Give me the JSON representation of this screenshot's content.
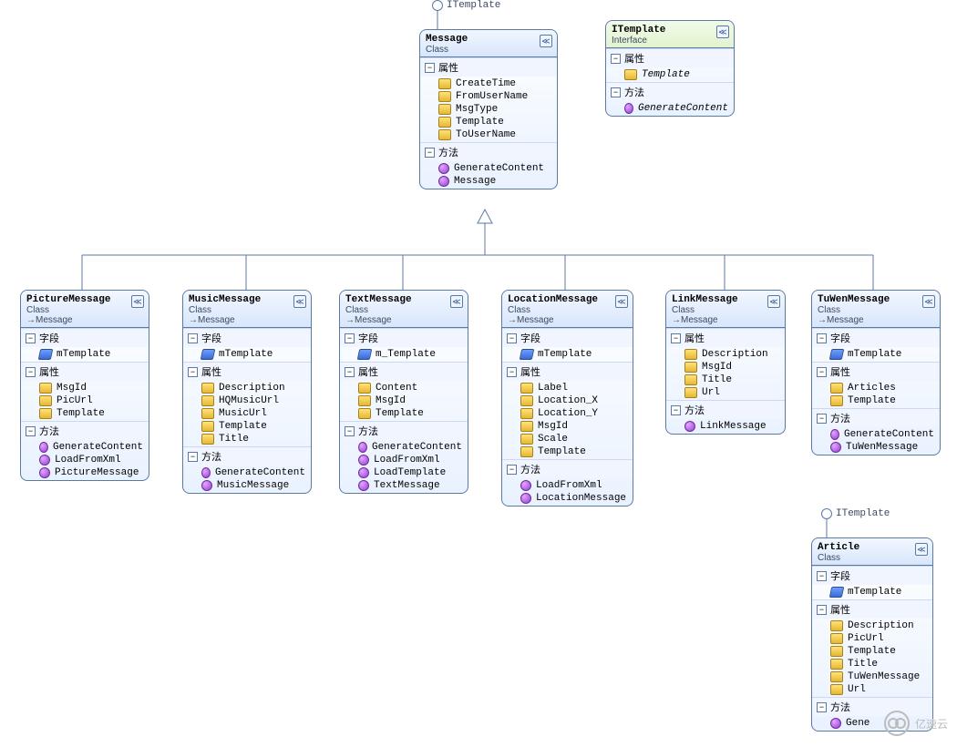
{
  "labels": {
    "class": "Class",
    "interface": "Interface",
    "inherits_prefix": "→",
    "sec_fields": "字段",
    "sec_props": "属性",
    "sec_methods": "方法",
    "chevron": "≪",
    "collapse": "−"
  },
  "lollipops": {
    "message": "ITemplate",
    "article": "ITemplate"
  },
  "watermark": "亿速云",
  "classes": {
    "Message": {
      "name": "Message",
      "kind": "class",
      "inherits": null,
      "sections": [
        {
          "type": "props",
          "items": [
            {
              "name": "CreateTime"
            },
            {
              "name": "FromUserName"
            },
            {
              "name": "MsgType"
            },
            {
              "name": "Template"
            },
            {
              "name": "ToUserName"
            }
          ]
        },
        {
          "type": "methods",
          "items": [
            {
              "name": "GenerateContent"
            },
            {
              "name": "Message"
            }
          ]
        }
      ]
    },
    "ITemplate": {
      "name": "ITemplate",
      "kind": "interface",
      "inherits": null,
      "sections": [
        {
          "type": "props",
          "items": [
            {
              "name": "Template",
              "italic": true
            }
          ]
        },
        {
          "type": "methods",
          "items": [
            {
              "name": "GenerateContent",
              "italic": true
            }
          ]
        }
      ]
    },
    "PictureMessage": {
      "name": "PictureMessage",
      "kind": "class",
      "inherits": "Message",
      "sections": [
        {
          "type": "fields",
          "items": [
            {
              "name": "mTemplate"
            }
          ]
        },
        {
          "type": "props",
          "items": [
            {
              "name": "MsgId"
            },
            {
              "name": "PicUrl"
            },
            {
              "name": "Template"
            }
          ]
        },
        {
          "type": "methods",
          "items": [
            {
              "name": "GenerateContent"
            },
            {
              "name": "LoadFromXml"
            },
            {
              "name": "PictureMessage"
            }
          ]
        }
      ]
    },
    "MusicMessage": {
      "name": "MusicMessage",
      "kind": "class",
      "inherits": "Message",
      "sections": [
        {
          "type": "fields",
          "items": [
            {
              "name": "mTemplate"
            }
          ]
        },
        {
          "type": "props",
          "items": [
            {
              "name": "Description"
            },
            {
              "name": "HQMusicUrl"
            },
            {
              "name": "MusicUrl"
            },
            {
              "name": "Template"
            },
            {
              "name": "Title"
            }
          ]
        },
        {
          "type": "methods",
          "items": [
            {
              "name": "GenerateContent"
            },
            {
              "name": "MusicMessage"
            }
          ]
        }
      ]
    },
    "TextMessage": {
      "name": "TextMessage",
      "kind": "class",
      "inherits": "Message",
      "sections": [
        {
          "type": "fields",
          "items": [
            {
              "name": "m_Template"
            }
          ]
        },
        {
          "type": "props",
          "items": [
            {
              "name": "Content"
            },
            {
              "name": "MsgId"
            },
            {
              "name": "Template"
            }
          ]
        },
        {
          "type": "methods",
          "items": [
            {
              "name": "GenerateContent"
            },
            {
              "name": "LoadFromXml"
            },
            {
              "name": "LoadTemplate"
            },
            {
              "name": "TextMessage"
            }
          ]
        }
      ]
    },
    "LocationMessage": {
      "name": "LocationMessage",
      "kind": "class",
      "inherits": "Message",
      "sections": [
        {
          "type": "fields",
          "items": [
            {
              "name": "mTemplate"
            }
          ]
        },
        {
          "type": "props",
          "items": [
            {
              "name": "Label"
            },
            {
              "name": "Location_X"
            },
            {
              "name": "Location_Y"
            },
            {
              "name": "MsgId"
            },
            {
              "name": "Scale"
            },
            {
              "name": "Template"
            }
          ]
        },
        {
          "type": "methods",
          "items": [
            {
              "name": "LoadFromXml"
            },
            {
              "name": "LocationMessage"
            }
          ]
        }
      ]
    },
    "LinkMessage": {
      "name": "LinkMessage",
      "kind": "class",
      "inherits": "Message",
      "sections": [
        {
          "type": "props",
          "items": [
            {
              "name": "Description"
            },
            {
              "name": "MsgId"
            },
            {
              "name": "Title"
            },
            {
              "name": "Url"
            }
          ]
        },
        {
          "type": "methods",
          "items": [
            {
              "name": "LinkMessage"
            }
          ]
        }
      ]
    },
    "TuWenMessage": {
      "name": "TuWenMessage",
      "kind": "class",
      "inherits": "Message",
      "sections": [
        {
          "type": "fields",
          "items": [
            {
              "name": "mTemplate"
            }
          ]
        },
        {
          "type": "props",
          "items": [
            {
              "name": "Articles"
            },
            {
              "name": "Template"
            }
          ]
        },
        {
          "type": "methods",
          "items": [
            {
              "name": "GenerateContent"
            },
            {
              "name": "TuWenMessage"
            }
          ]
        }
      ]
    },
    "Article": {
      "name": "Article",
      "kind": "class",
      "inherits": null,
      "sections": [
        {
          "type": "fields",
          "items": [
            {
              "name": "mTemplate"
            }
          ]
        },
        {
          "type": "props",
          "items": [
            {
              "name": "Description"
            },
            {
              "name": "PicUrl"
            },
            {
              "name": "Template"
            },
            {
              "name": "Title"
            },
            {
              "name": "TuWenMessage"
            },
            {
              "name": "Url"
            }
          ]
        },
        {
          "type": "methods",
          "items": [
            {
              "name": "Gene"
            }
          ]
        }
      ]
    }
  }
}
